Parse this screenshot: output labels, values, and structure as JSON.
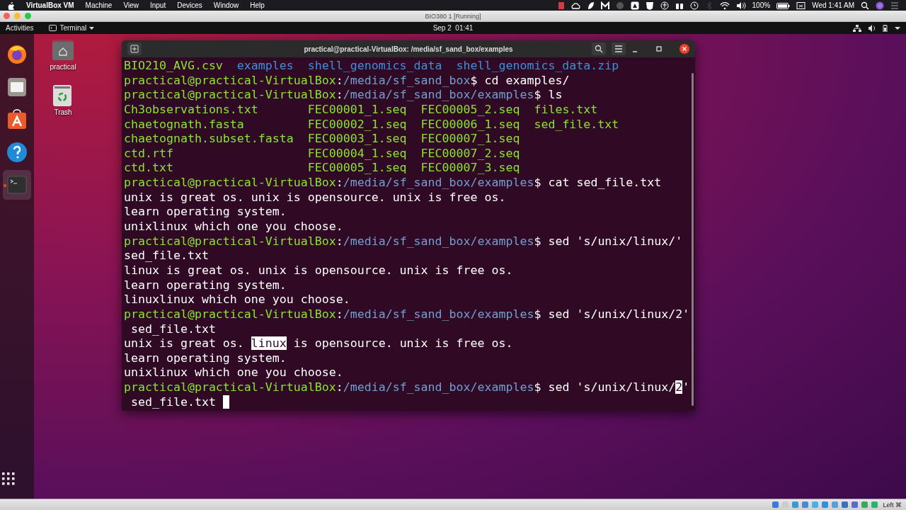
{
  "menubar": {
    "app": "VirtualBox VM",
    "menus": [
      "Machine",
      "View",
      "Input",
      "Devices",
      "Window",
      "Help"
    ],
    "battery": "100%",
    "clock": "Wed 1:41 AM"
  },
  "vm_window": {
    "title": "BIO380 1 [Running]"
  },
  "topbar": {
    "activities": "Activities",
    "app_menu": "Terminal",
    "clock": "Sep 2  01:41"
  },
  "dock": {
    "items": [
      {
        "kind": "browser",
        "selected": false,
        "running": false
      },
      {
        "kind": "files",
        "selected": false,
        "running": false
      },
      {
        "kind": "software",
        "selected": false,
        "running": false
      },
      {
        "kind": "help",
        "selected": false,
        "running": false
      },
      {
        "kind": "terminal",
        "selected": true,
        "running": true
      }
    ]
  },
  "desktop_icons": [
    {
      "kind": "home",
      "label": "practical"
    },
    {
      "kind": "trash",
      "label": "Trash"
    }
  ],
  "terminal": {
    "title": "practical@practical-VirtualBox: /media/sf_sand_box/examples",
    "lines": [
      {
        "kind": "ls",
        "rows": [
          [
            {
              "text": "BIO210_AVG.csv",
              "kind": "exec"
            },
            {
              "text": "examples",
              "kind": "dir"
            },
            {
              "text": "shell_genomics_data",
              "kind": "dir"
            },
            {
              "text": "shell_genomics_data.zip",
              "kind": "dir"
            }
          ]
        ]
      },
      {
        "kind": "segments",
        "segments": [
          {
            "text": "practical@practical-VirtualBox",
            "kind": "user"
          },
          {
            "text": ":",
            "kind": "plain"
          },
          {
            "text": "/media/sf_sand_box",
            "kind": "path"
          },
          {
            "text": "$ cd examples/",
            "kind": "plain"
          }
        ]
      },
      {
        "kind": "segments",
        "segments": [
          {
            "text": "practical@practical-VirtualBox",
            "kind": "user"
          },
          {
            "text": ":",
            "kind": "plain"
          },
          {
            "text": "/media/sf_sand_box/examples",
            "kind": "path"
          },
          {
            "text": "$ ls",
            "kind": "plain"
          }
        ]
      },
      {
        "kind": "ls",
        "rows": [
          [
            {
              "text": "Ch3observations.txt",
              "kind": "exec"
            },
            {
              "text": "FEC00001_1.seq",
              "kind": "exec"
            },
            {
              "text": "FEC00005_2.seq",
              "kind": "exec"
            },
            {
              "text": "files.txt",
              "kind": "exec"
            }
          ],
          [
            {
              "text": "chaetognath.fasta",
              "kind": "exec"
            },
            {
              "text": "FEC00002_1.seq",
              "kind": "exec"
            },
            {
              "text": "FEC00006_1.seq",
              "kind": "exec"
            },
            {
              "text": "sed_file.txt",
              "kind": "exec"
            }
          ],
          [
            {
              "text": "chaetognath.subset.fasta",
              "kind": "exec"
            },
            {
              "text": "FEC00003_1.seq",
              "kind": "exec"
            },
            {
              "text": "FEC00007_1.seq",
              "kind": "exec"
            }
          ],
          [
            {
              "text": "ctd.rtf",
              "kind": "exec"
            },
            {
              "text": "FEC00004_1.seq",
              "kind": "exec"
            },
            {
              "text": "FEC00007_2.seq",
              "kind": "exec"
            }
          ],
          [
            {
              "text": "ctd.txt",
              "kind": "exec"
            },
            {
              "text": "FEC00005_1.seq",
              "kind": "exec"
            },
            {
              "text": "FEC00007_3.seq",
              "kind": "exec"
            }
          ]
        ]
      },
      {
        "kind": "segments",
        "segments": [
          {
            "text": "practical@practical-VirtualBox",
            "kind": "user"
          },
          {
            "text": ":",
            "kind": "plain"
          },
          {
            "text": "/media/sf_sand_box/examples",
            "kind": "path"
          },
          {
            "text": "$ cat sed_file.txt",
            "kind": "plain"
          }
        ]
      },
      {
        "kind": "segments",
        "segments": [
          {
            "text": "unix is great os. unix is opensource. unix is free os.",
            "kind": "plain"
          }
        ]
      },
      {
        "kind": "segments",
        "segments": [
          {
            "text": "learn operating system.",
            "kind": "plain"
          }
        ]
      },
      {
        "kind": "segments",
        "segments": [
          {
            "text": "unixlinux which one you choose.",
            "kind": "plain"
          }
        ]
      },
      {
        "kind": "segments",
        "segments": [
          {
            "text": "practical@practical-VirtualBox",
            "kind": "user"
          },
          {
            "text": ":",
            "kind": "plain"
          },
          {
            "text": "/media/sf_sand_box/examples",
            "kind": "path"
          },
          {
            "text": "$ sed 's/unix/linux/'",
            "kind": "plain"
          }
        ]
      },
      {
        "kind": "segments",
        "segments": [
          {
            "text": "sed_file.txt",
            "kind": "plain"
          }
        ]
      },
      {
        "kind": "segments",
        "segments": [
          {
            "text": "linux is great os. unix is opensource. unix is free os.",
            "kind": "plain"
          }
        ]
      },
      {
        "kind": "segments",
        "segments": [
          {
            "text": "learn operating system.",
            "kind": "plain"
          }
        ]
      },
      {
        "kind": "segments",
        "segments": [
          {
            "text": "linuxlinux which one you choose.",
            "kind": "plain"
          }
        ]
      },
      {
        "kind": "segments",
        "segments": [
          {
            "text": "practical@practical-VirtualBox",
            "kind": "user"
          },
          {
            "text": ":",
            "kind": "plain"
          },
          {
            "text": "/media/sf_sand_box/examples",
            "kind": "path"
          },
          {
            "text": "$ sed 's/unix/linux/2'",
            "kind": "plain"
          }
        ]
      },
      {
        "kind": "segments",
        "segments": [
          {
            "text": " sed_file.txt",
            "kind": "plain"
          }
        ]
      },
      {
        "kind": "segments",
        "segments": [
          {
            "text": "unix is great os. ",
            "kind": "plain"
          },
          {
            "text": "linux",
            "kind": "highlight"
          },
          {
            "text": " is opensource. unix is free os.",
            "kind": "plain"
          }
        ]
      },
      {
        "kind": "segments",
        "segments": [
          {
            "text": "learn operating system.",
            "kind": "plain"
          }
        ]
      },
      {
        "kind": "segments",
        "segments": [
          {
            "text": "unixlinux which one you choose.",
            "kind": "plain"
          }
        ]
      },
      {
        "kind": "segments",
        "segments": [
          {
            "text": "practical@practical-VirtualBox",
            "kind": "user"
          },
          {
            "text": ":",
            "kind": "plain"
          },
          {
            "text": "/media/sf_sand_box/examples",
            "kind": "path"
          },
          {
            "text": "$ sed 's/unix/linux/",
            "kind": "plain"
          },
          {
            "text": "2",
            "kind": "cursor"
          },
          {
            "text": "'",
            "kind": "plain"
          }
        ]
      },
      {
        "kind": "segments",
        "cursor": true,
        "segments": [
          {
            "text": " sed_file.txt ",
            "kind": "plain"
          }
        ]
      }
    ]
  },
  "statusbar": {
    "host_key": "Left ⌘"
  }
}
